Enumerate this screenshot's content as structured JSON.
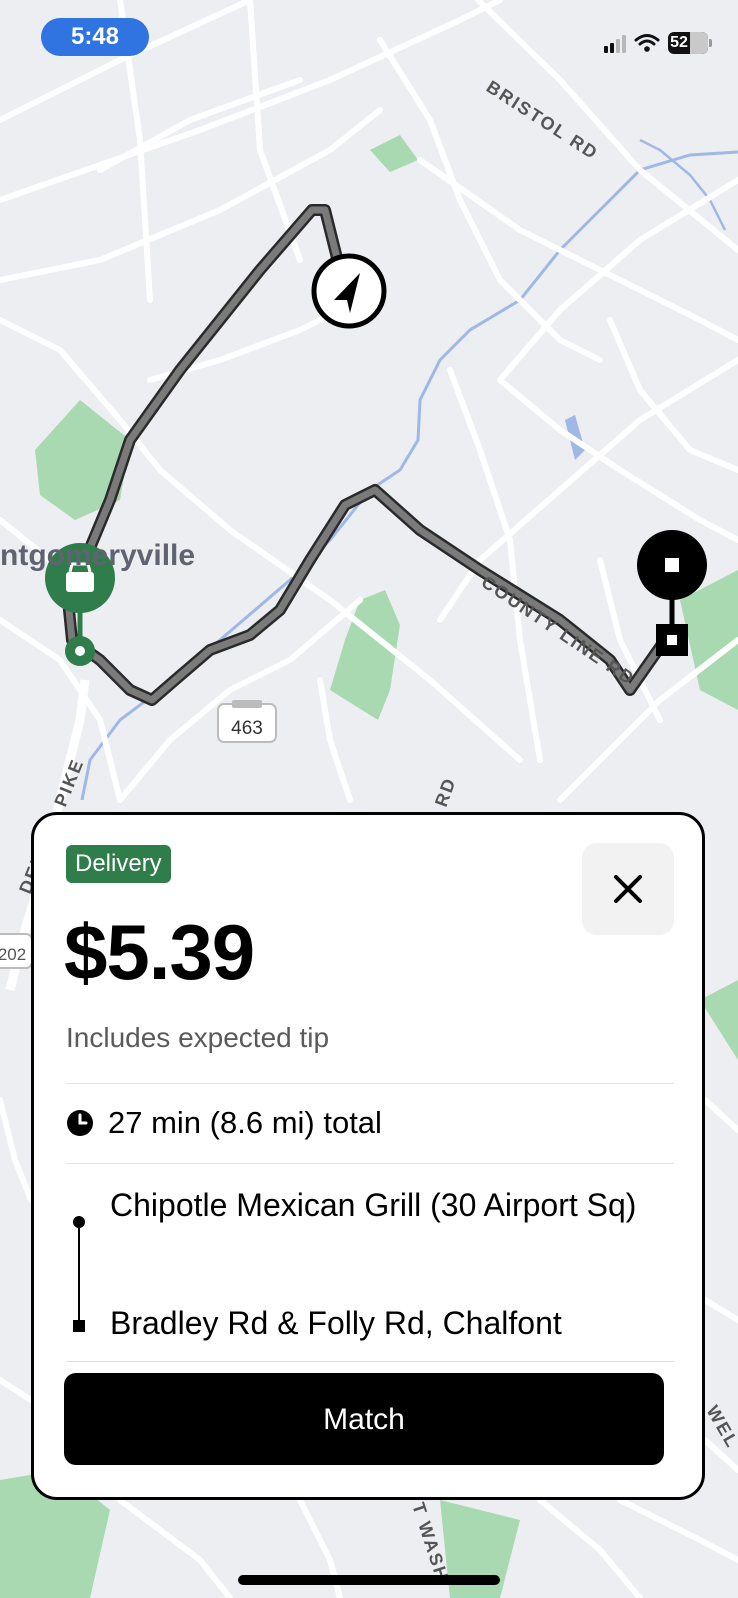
{
  "status_bar": {
    "time": "5:48",
    "battery": "52"
  },
  "map": {
    "town_label": "ntgomeryville",
    "road_labels": [
      "BRISTOL RD",
      "COUNTY LINE RD",
      "DEKALB PIKE",
      "RD",
      "WEL",
      "T WASH",
      "202"
    ],
    "route_shield": "463",
    "icons": {
      "navigation": "navigation-arrow-icon",
      "pickup": "shopping-bag-icon",
      "dropoff": "stop-square-icon"
    },
    "colors": {
      "route": "#6b6b6b",
      "park": "#a8d9b0",
      "water": "#9fb8e6",
      "pickup": "#2e7d4a"
    }
  },
  "offer": {
    "badge": "Delivery",
    "price": "$5.39",
    "subtitle": "Includes expected tip",
    "trip_summary": "27 min (8.6 mi) total",
    "pickup": "Chipotle Mexican Grill (30 Airport Sq)",
    "dropoff": "Bradley Rd & Folly Rd, Chalfont",
    "action": "Match",
    "icons": {
      "close": "close-icon",
      "clock": "clock-icon"
    },
    "colors": {
      "badge": "#2e7d4a",
      "button": "#000000"
    }
  }
}
